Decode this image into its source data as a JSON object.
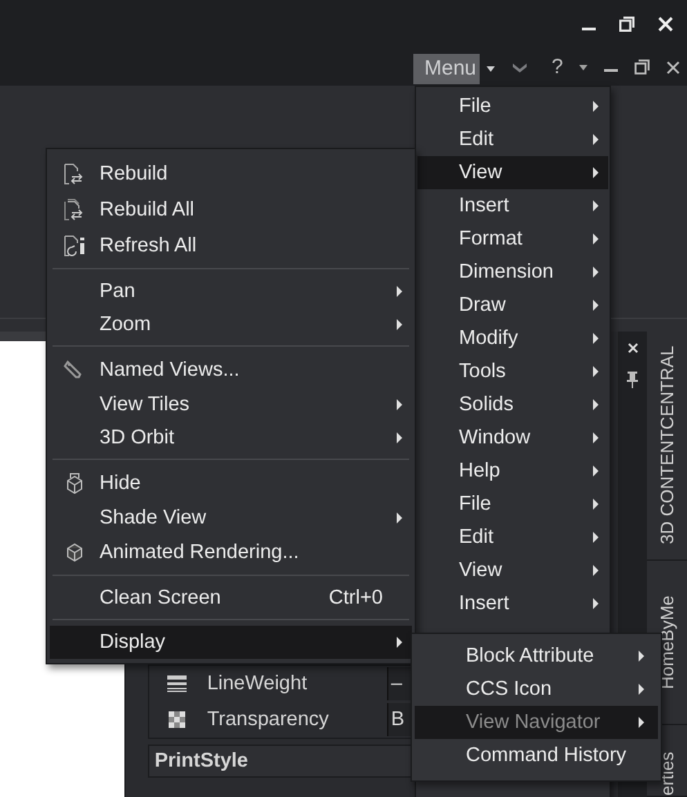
{
  "menu_button": {
    "label": "Menu"
  },
  "help_button": {
    "label": "?"
  },
  "main_menu": [
    {
      "label": "File",
      "submenu": true,
      "selected": false
    },
    {
      "label": "Edit",
      "submenu": true,
      "selected": false
    },
    {
      "label": "View",
      "submenu": true,
      "selected": true
    },
    {
      "label": "Insert",
      "submenu": true,
      "selected": false
    },
    {
      "label": "Format",
      "submenu": true,
      "selected": false
    },
    {
      "label": "Dimension",
      "submenu": true,
      "selected": false
    },
    {
      "label": "Draw",
      "submenu": true,
      "selected": false
    },
    {
      "label": "Modify",
      "submenu": true,
      "selected": false
    },
    {
      "label": "Tools",
      "submenu": true,
      "selected": false
    },
    {
      "label": "Solids",
      "submenu": true,
      "selected": false
    },
    {
      "label": "Window",
      "submenu": true,
      "selected": false
    },
    {
      "label": "Help",
      "submenu": true,
      "selected": false
    },
    {
      "label": "File",
      "submenu": true,
      "selected": false
    },
    {
      "label": "Edit",
      "submenu": true,
      "selected": false
    },
    {
      "label": "View",
      "submenu": true,
      "selected": false
    },
    {
      "label": "Insert",
      "submenu": true,
      "selected": false
    }
  ],
  "view_menu": [
    {
      "kind": "item",
      "label": "Rebuild",
      "submenu": false,
      "selected": false
    },
    {
      "kind": "item",
      "label": "Rebuild All",
      "submenu": false,
      "selected": false
    },
    {
      "kind": "item",
      "label": "Refresh All",
      "submenu": false,
      "selected": false
    },
    {
      "kind": "separator"
    },
    {
      "kind": "item",
      "label": "Pan",
      "submenu": true,
      "selected": false
    },
    {
      "kind": "item",
      "label": "Zoom",
      "submenu": true,
      "selected": false
    },
    {
      "kind": "separator"
    },
    {
      "kind": "item",
      "label": "Named Views...",
      "submenu": false,
      "selected": false
    },
    {
      "kind": "item",
      "label": "View Tiles",
      "submenu": true,
      "selected": false
    },
    {
      "kind": "item",
      "label": "3D Orbit",
      "submenu": true,
      "selected": false
    },
    {
      "kind": "separator"
    },
    {
      "kind": "item",
      "label": "Hide",
      "submenu": false,
      "selected": false
    },
    {
      "kind": "item",
      "label": "Shade View",
      "submenu": true,
      "selected": false
    },
    {
      "kind": "item",
      "label": "Animated Rendering...",
      "submenu": false,
      "selected": false
    },
    {
      "kind": "separator"
    },
    {
      "kind": "item",
      "label": "Clean Screen",
      "shortcut": "Ctrl+0",
      "submenu": false,
      "selected": false
    },
    {
      "kind": "separator"
    },
    {
      "kind": "item",
      "label": "Display",
      "submenu": true,
      "selected": true
    }
  ],
  "display_menu": [
    {
      "label": "Block Attribute",
      "submenu": true,
      "selected": false,
      "disabled": false
    },
    {
      "label": "CCS Icon",
      "submenu": true,
      "selected": false,
      "disabled": false
    },
    {
      "label": "View Navigator",
      "submenu": true,
      "selected": true,
      "disabled": true
    },
    {
      "label": "Command History",
      "submenu": false,
      "selected": false,
      "disabled": false
    }
  ],
  "properties": {
    "rows": [
      {
        "kind": "lineweight",
        "label": "LineWeight",
        "value": "–"
      },
      {
        "kind": "transparency",
        "label": "Transparency",
        "value": "B"
      }
    ],
    "section": "PrintStyle"
  },
  "side_tabs": [
    "3D CONTENTCENTRAL",
    "HomeByMe",
    "erties"
  ]
}
